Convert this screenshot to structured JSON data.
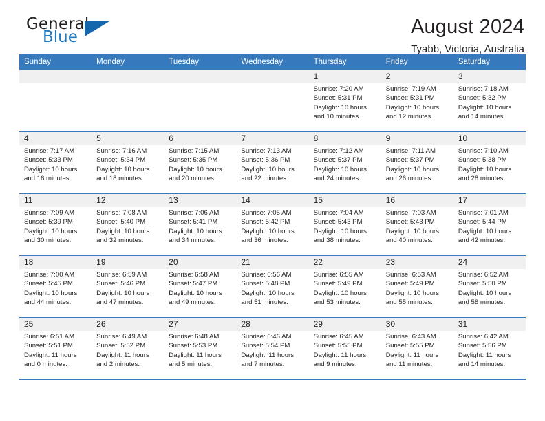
{
  "brand": {
    "name_part1": "General",
    "name_part2": "Blue",
    "triangle_color": "#1567ad",
    "blue_color": "#2179bf"
  },
  "header": {
    "title": "August 2024",
    "subtitle": "Tyabb, Victoria, Australia"
  },
  "calendar": {
    "accent_color": "#3679bc",
    "daynum_bg": "#f0f0f0",
    "weekday_headers": [
      "Sunday",
      "Monday",
      "Tuesday",
      "Wednesday",
      "Thursday",
      "Friday",
      "Saturday"
    ],
    "weeks": [
      [
        {
          "day": "",
          "sunrise": "",
          "sunset": "",
          "daylight_line1": "",
          "daylight_line2": ""
        },
        {
          "day": "",
          "sunrise": "",
          "sunset": "",
          "daylight_line1": "",
          "daylight_line2": ""
        },
        {
          "day": "",
          "sunrise": "",
          "sunset": "",
          "daylight_line1": "",
          "daylight_line2": ""
        },
        {
          "day": "",
          "sunrise": "",
          "sunset": "",
          "daylight_line1": "",
          "daylight_line2": ""
        },
        {
          "day": "1",
          "sunrise": "Sunrise: 7:20 AM",
          "sunset": "Sunset: 5:31 PM",
          "daylight_line1": "Daylight: 10 hours",
          "daylight_line2": "and 10 minutes."
        },
        {
          "day": "2",
          "sunrise": "Sunrise: 7:19 AM",
          "sunset": "Sunset: 5:31 PM",
          "daylight_line1": "Daylight: 10 hours",
          "daylight_line2": "and 12 minutes."
        },
        {
          "day": "3",
          "sunrise": "Sunrise: 7:18 AM",
          "sunset": "Sunset: 5:32 PM",
          "daylight_line1": "Daylight: 10 hours",
          "daylight_line2": "and 14 minutes."
        }
      ],
      [
        {
          "day": "4",
          "sunrise": "Sunrise: 7:17 AM",
          "sunset": "Sunset: 5:33 PM",
          "daylight_line1": "Daylight: 10 hours",
          "daylight_line2": "and 16 minutes."
        },
        {
          "day": "5",
          "sunrise": "Sunrise: 7:16 AM",
          "sunset": "Sunset: 5:34 PM",
          "daylight_line1": "Daylight: 10 hours",
          "daylight_line2": "and 18 minutes."
        },
        {
          "day": "6",
          "sunrise": "Sunrise: 7:15 AM",
          "sunset": "Sunset: 5:35 PM",
          "daylight_line1": "Daylight: 10 hours",
          "daylight_line2": "and 20 minutes."
        },
        {
          "day": "7",
          "sunrise": "Sunrise: 7:13 AM",
          "sunset": "Sunset: 5:36 PM",
          "daylight_line1": "Daylight: 10 hours",
          "daylight_line2": "and 22 minutes."
        },
        {
          "day": "8",
          "sunrise": "Sunrise: 7:12 AM",
          "sunset": "Sunset: 5:37 PM",
          "daylight_line1": "Daylight: 10 hours",
          "daylight_line2": "and 24 minutes."
        },
        {
          "day": "9",
          "sunrise": "Sunrise: 7:11 AM",
          "sunset": "Sunset: 5:37 PM",
          "daylight_line1": "Daylight: 10 hours",
          "daylight_line2": "and 26 minutes."
        },
        {
          "day": "10",
          "sunrise": "Sunrise: 7:10 AM",
          "sunset": "Sunset: 5:38 PM",
          "daylight_line1": "Daylight: 10 hours",
          "daylight_line2": "and 28 minutes."
        }
      ],
      [
        {
          "day": "11",
          "sunrise": "Sunrise: 7:09 AM",
          "sunset": "Sunset: 5:39 PM",
          "daylight_line1": "Daylight: 10 hours",
          "daylight_line2": "and 30 minutes."
        },
        {
          "day": "12",
          "sunrise": "Sunrise: 7:08 AM",
          "sunset": "Sunset: 5:40 PM",
          "daylight_line1": "Daylight: 10 hours",
          "daylight_line2": "and 32 minutes."
        },
        {
          "day": "13",
          "sunrise": "Sunrise: 7:06 AM",
          "sunset": "Sunset: 5:41 PM",
          "daylight_line1": "Daylight: 10 hours",
          "daylight_line2": "and 34 minutes."
        },
        {
          "day": "14",
          "sunrise": "Sunrise: 7:05 AM",
          "sunset": "Sunset: 5:42 PM",
          "daylight_line1": "Daylight: 10 hours",
          "daylight_line2": "and 36 minutes."
        },
        {
          "day": "15",
          "sunrise": "Sunrise: 7:04 AM",
          "sunset": "Sunset: 5:43 PM",
          "daylight_line1": "Daylight: 10 hours",
          "daylight_line2": "and 38 minutes."
        },
        {
          "day": "16",
          "sunrise": "Sunrise: 7:03 AM",
          "sunset": "Sunset: 5:43 PM",
          "daylight_line1": "Daylight: 10 hours",
          "daylight_line2": "and 40 minutes."
        },
        {
          "day": "17",
          "sunrise": "Sunrise: 7:01 AM",
          "sunset": "Sunset: 5:44 PM",
          "daylight_line1": "Daylight: 10 hours",
          "daylight_line2": "and 42 minutes."
        }
      ],
      [
        {
          "day": "18",
          "sunrise": "Sunrise: 7:00 AM",
          "sunset": "Sunset: 5:45 PM",
          "daylight_line1": "Daylight: 10 hours",
          "daylight_line2": "and 44 minutes."
        },
        {
          "day": "19",
          "sunrise": "Sunrise: 6:59 AM",
          "sunset": "Sunset: 5:46 PM",
          "daylight_line1": "Daylight: 10 hours",
          "daylight_line2": "and 47 minutes."
        },
        {
          "day": "20",
          "sunrise": "Sunrise: 6:58 AM",
          "sunset": "Sunset: 5:47 PM",
          "daylight_line1": "Daylight: 10 hours",
          "daylight_line2": "and 49 minutes."
        },
        {
          "day": "21",
          "sunrise": "Sunrise: 6:56 AM",
          "sunset": "Sunset: 5:48 PM",
          "daylight_line1": "Daylight: 10 hours",
          "daylight_line2": "and 51 minutes."
        },
        {
          "day": "22",
          "sunrise": "Sunrise: 6:55 AM",
          "sunset": "Sunset: 5:49 PM",
          "daylight_line1": "Daylight: 10 hours",
          "daylight_line2": "and 53 minutes."
        },
        {
          "day": "23",
          "sunrise": "Sunrise: 6:53 AM",
          "sunset": "Sunset: 5:49 PM",
          "daylight_line1": "Daylight: 10 hours",
          "daylight_line2": "and 55 minutes."
        },
        {
          "day": "24",
          "sunrise": "Sunrise: 6:52 AM",
          "sunset": "Sunset: 5:50 PM",
          "daylight_line1": "Daylight: 10 hours",
          "daylight_line2": "and 58 minutes."
        }
      ],
      [
        {
          "day": "25",
          "sunrise": "Sunrise: 6:51 AM",
          "sunset": "Sunset: 5:51 PM",
          "daylight_line1": "Daylight: 11 hours",
          "daylight_line2": "and 0 minutes."
        },
        {
          "day": "26",
          "sunrise": "Sunrise: 6:49 AM",
          "sunset": "Sunset: 5:52 PM",
          "daylight_line1": "Daylight: 11 hours",
          "daylight_line2": "and 2 minutes."
        },
        {
          "day": "27",
          "sunrise": "Sunrise: 6:48 AM",
          "sunset": "Sunset: 5:53 PM",
          "daylight_line1": "Daylight: 11 hours",
          "daylight_line2": "and 5 minutes."
        },
        {
          "day": "28",
          "sunrise": "Sunrise: 6:46 AM",
          "sunset": "Sunset: 5:54 PM",
          "daylight_line1": "Daylight: 11 hours",
          "daylight_line2": "and 7 minutes."
        },
        {
          "day": "29",
          "sunrise": "Sunrise: 6:45 AM",
          "sunset": "Sunset: 5:55 PM",
          "daylight_line1": "Daylight: 11 hours",
          "daylight_line2": "and 9 minutes."
        },
        {
          "day": "30",
          "sunrise": "Sunrise: 6:43 AM",
          "sunset": "Sunset: 5:55 PM",
          "daylight_line1": "Daylight: 11 hours",
          "daylight_line2": "and 11 minutes."
        },
        {
          "day": "31",
          "sunrise": "Sunrise: 6:42 AM",
          "sunset": "Sunset: 5:56 PM",
          "daylight_line1": "Daylight: 11 hours",
          "daylight_line2": "and 14 minutes."
        }
      ]
    ]
  }
}
